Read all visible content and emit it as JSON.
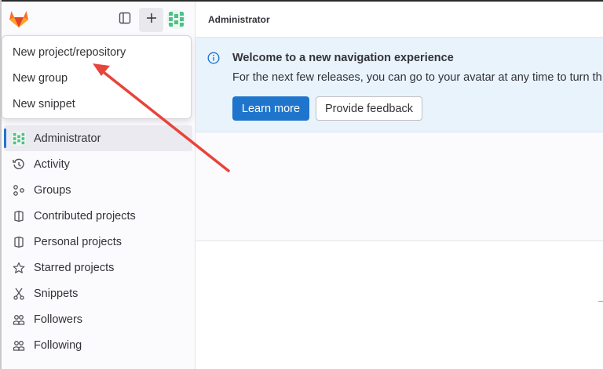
{
  "sidebar": {
    "logo": "gitlab-tanuki-logo",
    "toggle_icon": "sidebar-toggle-icon",
    "plus_icon": "plus-icon",
    "avatar_icon": "user-avatar",
    "items": [
      {
        "label": "Administrator",
        "icon": "avatar-icon",
        "active": true
      },
      {
        "label": "Activity",
        "icon": "history-icon"
      },
      {
        "label": "Groups",
        "icon": "group-icon"
      },
      {
        "label": "Contributed projects",
        "icon": "project-icon"
      },
      {
        "label": "Personal projects",
        "icon": "project-icon"
      },
      {
        "label": "Starred projects",
        "icon": "star-icon"
      },
      {
        "label": "Snippets",
        "icon": "snippet-icon"
      },
      {
        "label": "Followers",
        "icon": "users-icon"
      },
      {
        "label": "Following",
        "icon": "users-icon"
      }
    ]
  },
  "dropdown": {
    "items": [
      "New project/repository",
      "New group",
      "New snippet"
    ]
  },
  "main": {
    "breadcrumb": "Administrator",
    "banner": {
      "title": "Welcome to a new navigation experience",
      "body": "For the next few releases, you can go to your avatar at any time to turn th",
      "primary_button": "Learn more",
      "secondary_button": "Provide feedback"
    }
  },
  "colors": {
    "accent": "#1f75cb",
    "banner_bg": "#e9f3fc",
    "sidebar_bg": "#fbfafd",
    "annotation_arrow": "#e8443a"
  }
}
